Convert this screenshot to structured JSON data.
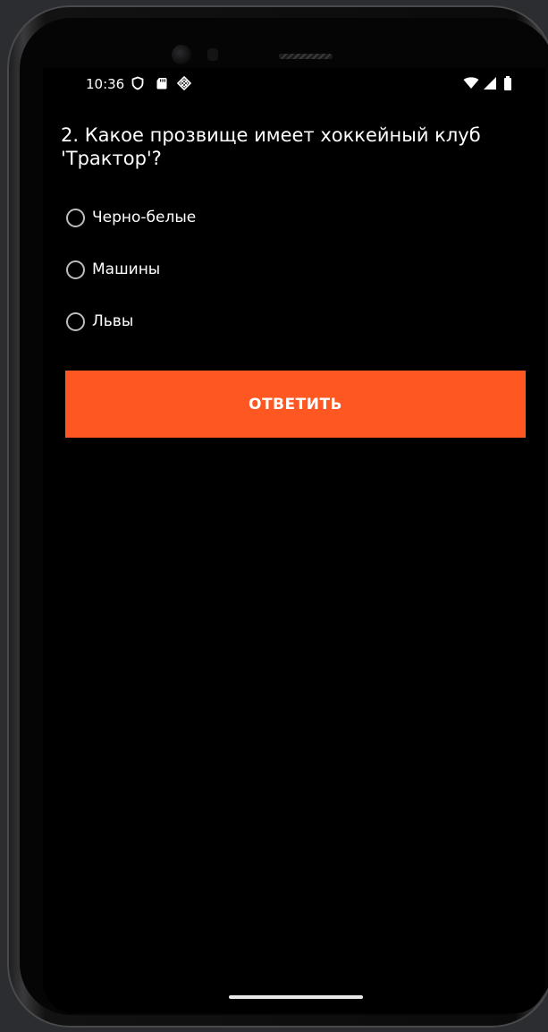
{
  "status_bar": {
    "time": "10:36",
    "left_icons": [
      "shield-icon",
      "sd-card-icon",
      "data-saver-icon"
    ],
    "right_icons": [
      "wifi-icon",
      "cell-signal-icon",
      "battery-icon"
    ]
  },
  "quiz": {
    "question": "2. Какое прозвище имеет хоккейный клуб 'Трактор'?",
    "options": [
      {
        "label": "Черно-белые",
        "selected": false
      },
      {
        "label": "Машины",
        "selected": false
      },
      {
        "label": "Львы",
        "selected": false
      }
    ],
    "submit_label": "ОТВЕТИТЬ"
  },
  "colors": {
    "background": "#000000",
    "accent": "#ff5722",
    "text": "#ffffff"
  }
}
